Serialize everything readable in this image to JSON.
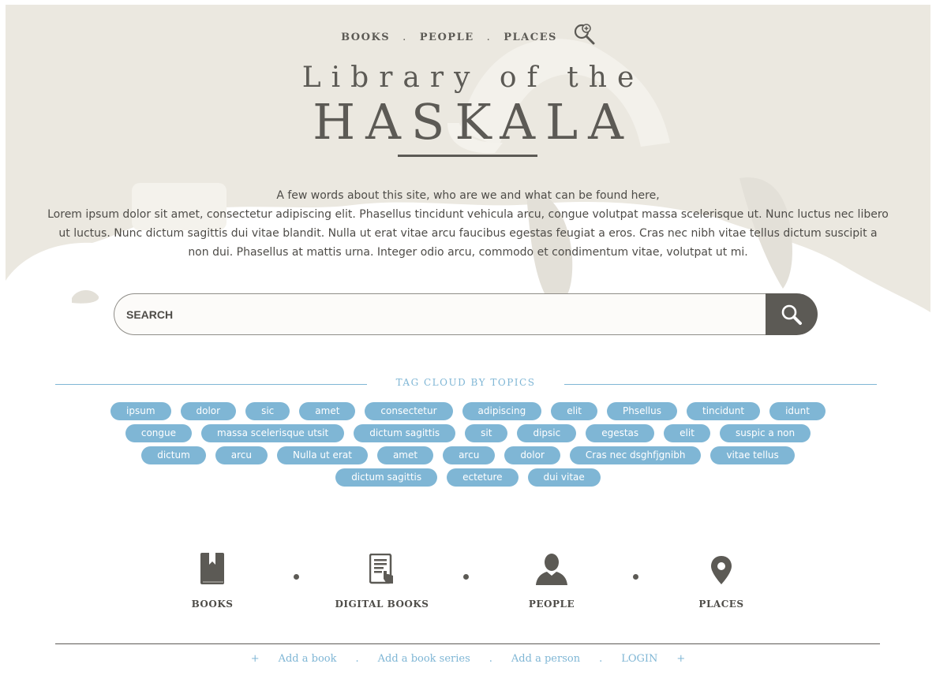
{
  "nav": {
    "books": "BOOKS",
    "people": "PEOPLE",
    "places": "PLACES",
    "separator": ".",
    "zoom_icon": "search-plus-icon"
  },
  "hero": {
    "title_line1": "Library of the",
    "title_line2": "HASKALA",
    "intro_line1": "A few words about this site, who are we and what can be found here,",
    "intro_body": "Lorem ipsum dolor sit amet, consectetur adipiscing elit. Phasellus tincidunt vehicula arcu, congue volutpat massa scelerisque ut. Nunc luctus nec libero ut luctus. Nunc dictum sagittis dui vitae blandit. Nulla ut erat vitae arcu faucibus egestas feugiat a eros. Cras nec nibh vitae tellus dictum suscipit a non dui. Phasellus at mattis urna. Integer odio arcu, commodo et condimentum vitae, volutpat ut mi."
  },
  "search": {
    "placeholder": "SEARCH",
    "value": "",
    "button_icon": "search-icon"
  },
  "tag_cloud": {
    "heading": "TAG CLOUD BY TOPICS",
    "rows": [
      [
        "ipsum",
        "dolor",
        "sic",
        "amet",
        "consectetur",
        "adipiscing",
        "elit",
        "Phsellus",
        "tincidunt",
        "idunt"
      ],
      [
        "congue",
        "massa scelerisque utsit",
        "dictum sagittis",
        "sit",
        "dipsic",
        "egestas",
        "elit",
        "suspic a non"
      ],
      [
        "dictum",
        "arcu",
        "Nulla ut erat",
        "amet",
        "arcu",
        "dolor",
        "Cras nec dsghfjgnibh",
        "vitae tellus"
      ],
      [
        "dictum sagittis",
        "ecteture",
        "dui vitae"
      ]
    ]
  },
  "categories": [
    {
      "label": "BOOKS",
      "icon": "book-icon"
    },
    {
      "label": "DIGITAL BOOKS",
      "icon": "digital-book-icon"
    },
    {
      "label": "PEOPLE",
      "icon": "person-icon"
    },
    {
      "label": "PLACES",
      "icon": "map-pin-icon"
    }
  ],
  "footer": {
    "plus": "+",
    "separator": ".",
    "links": [
      "Add a book",
      "Add a book series",
      "Add a person",
      "LOGIN"
    ]
  },
  "colors": {
    "hero_bg": "#ebe8e0",
    "text_dark": "#5c5a55",
    "accent_blue": "#7fb6d5"
  }
}
